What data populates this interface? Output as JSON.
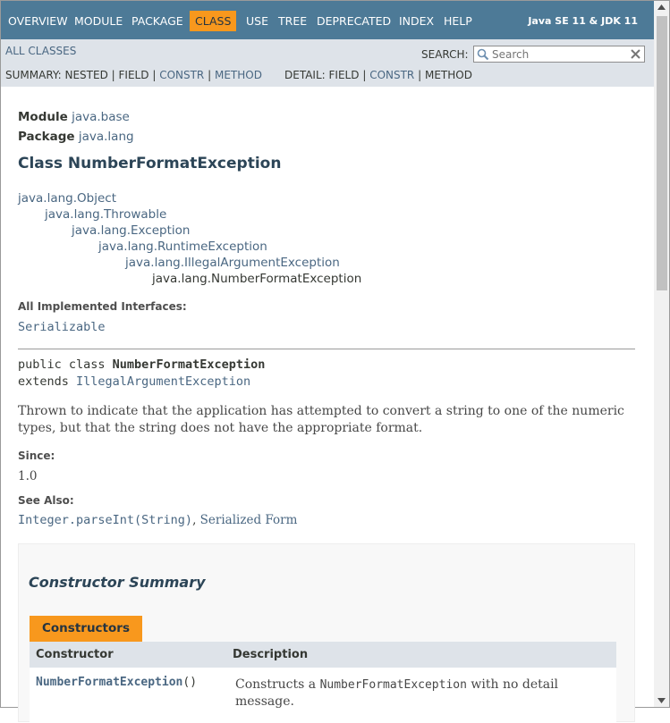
{
  "topnav": {
    "items": [
      "OVERVIEW",
      "MODULE",
      "PACKAGE",
      "CLASS",
      "USE",
      "TREE",
      "DEPRECATED",
      "INDEX",
      "HELP"
    ],
    "active": "CLASS",
    "about": "Java SE 11 & JDK 11"
  },
  "subnav": {
    "all_classes": "ALL CLASSES",
    "search_label": "SEARCH:",
    "search_placeholder": "Search",
    "summary_label": "SUMMARY:",
    "summary_links": [
      "NESTED",
      "FIELD",
      "CONSTR",
      "METHOD"
    ],
    "detail_label": "DETAIL:",
    "detail_links": [
      "FIELD",
      "CONSTR",
      "METHOD"
    ],
    "separator": "|"
  },
  "header": {
    "module_label": "Module",
    "module": "java.base",
    "package_label": "Package",
    "package": "java.lang",
    "title": "Class NumberFormatException"
  },
  "inheritance": [
    "java.lang.Object",
    "java.lang.Throwable",
    "java.lang.Exception",
    "java.lang.RuntimeException",
    "java.lang.IllegalArgumentException",
    "java.lang.NumberFormatException"
  ],
  "interfaces": {
    "label": "All Implemented Interfaces:",
    "value": "Serializable"
  },
  "signature": {
    "modifiers": "public class ",
    "name": "NumberFormatException",
    "extends_kw": "extends ",
    "superclass": "IllegalArgumentException"
  },
  "description": "Thrown to indicate that the application has attempted to convert a string to one of the numeric types, but that the string does not have the appropriate format.",
  "since": {
    "label": "Since:",
    "value": "1.0"
  },
  "see_also": {
    "label": "See Also:",
    "link1": "Integer.parseInt(String)",
    "sep": ", ",
    "link2": "Serialized Form"
  },
  "constructor_summary": {
    "heading": "Constructor Summary",
    "caption": "Constructors",
    "col_constructor": "Constructor",
    "col_description": "Description",
    "rows": [
      {
        "name": "NumberFormatException",
        "params": "()",
        "desc_pre": "Constructs a ",
        "desc_code": "NumberFormatException",
        "desc_post": " with no detail message."
      }
    ]
  },
  "colors": {
    "nav_bg": "#4D7A97",
    "active_tab": "#F8981D",
    "subnav_bg": "#dee3e9",
    "link": "#4A6782"
  }
}
